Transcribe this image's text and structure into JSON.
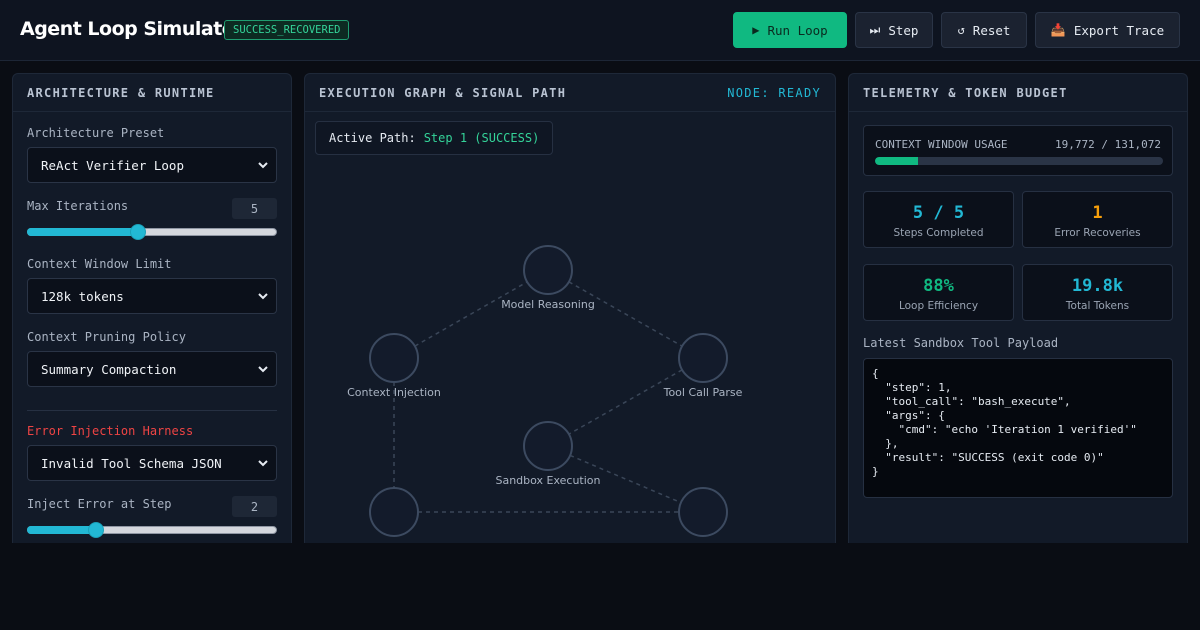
{
  "header": {
    "title": "Agent Loop Simulator",
    "status_badge": "SUCCESS_RECOVERED",
    "buttons": {
      "run": "Run Loop",
      "step": "Step",
      "reset": "Reset",
      "export": "Export Trace"
    },
    "icons": {
      "run": "play-icon",
      "step": "next-track-icon",
      "reset": "reset-icon",
      "export": "inbox-tray-icon"
    }
  },
  "config_panel": {
    "title": "ARCHITECTURE & RUNTIME",
    "architecture_preset": {
      "label": "Architecture Preset",
      "value": "ReAct Verifier Loop"
    },
    "max_iterations": {
      "label": "Max Iterations",
      "value": "5",
      "fraction": 0.44
    },
    "context_window": {
      "label": "Context Window Limit",
      "value": "128k tokens"
    },
    "pruning_policy": {
      "label": "Context Pruning Policy",
      "value": "Summary Compaction"
    },
    "error_harness": {
      "label": "Error Injection Harness",
      "value": "Invalid Tool Schema JSON"
    },
    "inject_step": {
      "label": "Inject Error at Step",
      "value": "2",
      "fraction": 0.26
    }
  },
  "graph_panel": {
    "title": "EXECUTION GRAPH & SIGNAL PATH",
    "node_status": "NODE: READY",
    "active_path_label": "Active Path:",
    "active_path_value": "Step 1 (SUCCESS)",
    "nodes": {
      "model_reasoning": "Model Reasoning",
      "context_injection": "Context Injection",
      "tool_call_parse": "Tool Call Parse",
      "sandbox_execution": "Sandbox Execution"
    }
  },
  "telemetry_panel": {
    "title": "TELEMETRY & TOKEN BUDGET",
    "context_usage": {
      "label": "CONTEXT WINDOW USAGE",
      "value": "19,772 / 131,072",
      "fraction": 0.151
    },
    "stats": [
      {
        "value": "5 / 5",
        "label": "Steps Completed",
        "color": "#22b8d4"
      },
      {
        "value": "1",
        "label": "Error Recoveries",
        "color": "#f59e0b"
      },
      {
        "value": "88%",
        "label": "Loop Efficiency",
        "color": "#10b981"
      },
      {
        "value": "19.8k",
        "label": "Total Tokens",
        "color": "#22b8d4"
      }
    ],
    "payload_label": "Latest Sandbox Tool Payload",
    "payload": "{\n  \"step\": 1,\n  \"tool_call\": \"bash_execute\",\n  \"args\": {\n    \"cmd\": \"echo 'Iteration 1 verified'\"\n  },\n  \"result\": \"SUCCESS (exit code 0)\"\n}"
  },
  "colors": {
    "accent": "#22b8d4",
    "success": "#10b981",
    "warning": "#f59e0b",
    "error": "#ef4444"
  }
}
